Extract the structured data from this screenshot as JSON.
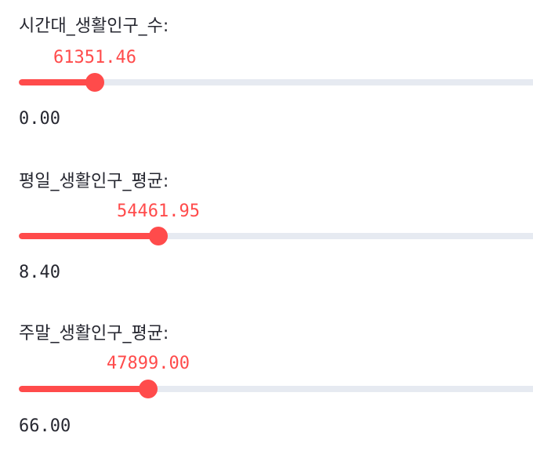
{
  "sliders": [
    {
      "label": "시간대_생활인구_수:",
      "value_text": "61351.46",
      "min_text": "0.00",
      "fill_fraction": 0.146,
      "accent": "#ff4b4b",
      "track_color": "#e6eaf1"
    },
    {
      "label": "평일_생활인구_평균:",
      "value_text": "54461.95",
      "min_text": "8.40",
      "fill_fraction": 0.268,
      "accent": "#ff4b4b",
      "track_color": "#e6eaf1"
    },
    {
      "label": "주말_생활인구_평균:",
      "value_text": "47899.00",
      "min_text": "66.00",
      "fill_fraction": 0.249,
      "accent": "#ff4b4b",
      "track_color": "#e6eaf1"
    }
  ]
}
